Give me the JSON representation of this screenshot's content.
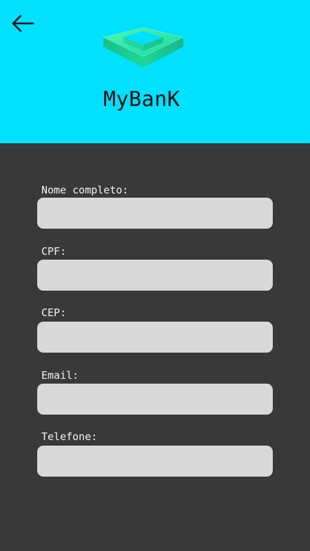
{
  "brand": {
    "name": "MyBanK"
  },
  "fields": {
    "full_name": {
      "label": "Nome completo:",
      "value": "",
      "placeholder": ""
    },
    "cpf": {
      "label": "CPF:",
      "value": "",
      "placeholder": ""
    },
    "cep": {
      "label": "CEP:",
      "value": "",
      "placeholder": ""
    },
    "email": {
      "label": "Email:",
      "value": "",
      "placeholder": ""
    },
    "phone": {
      "label": "Telefone:",
      "value": "",
      "placeholder": ""
    }
  },
  "icons": {
    "back": "arrow-left-icon",
    "logo": "cube-logo-icon"
  },
  "colors": {
    "header": "#00e0ff",
    "background": "#393939",
    "input": "#d9d9d9",
    "logo_light": "#35f2a6",
    "logo_mid": "#20d79a",
    "logo_dark": "#18b889"
  }
}
